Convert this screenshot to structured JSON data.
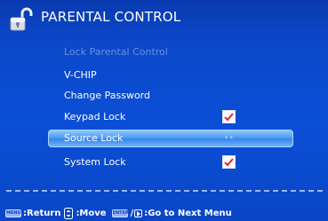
{
  "header": {
    "title": "PARENTAL CONTROL",
    "icon": "padlock-icon"
  },
  "menu": {
    "items": [
      {
        "label": "Lock Parental Control",
        "enabled": false,
        "checked": null
      },
      {
        "label": "V-CHIP",
        "enabled": true,
        "checked": null
      },
      {
        "label": "Change Password",
        "enabled": true,
        "checked": null
      },
      {
        "label": "Keypad Lock",
        "enabled": true,
        "checked": true
      },
      {
        "label": "Source Lock",
        "enabled": true,
        "checked": null,
        "selected": true,
        "indicator": "› ›"
      },
      {
        "label": "System Lock",
        "enabled": true,
        "checked": true
      }
    ]
  },
  "footer": {
    "menu_key": "MENU",
    "return_label": ":Return",
    "move_label": ":Move",
    "enter_key": "ENTER",
    "separator": "/",
    "next_label": ":Go to Next Menu"
  },
  "colors": {
    "background": "#0b4fd6",
    "highlight": "#4f9df5",
    "disabled_text": "#6b8fe3",
    "check": "#e0203a"
  }
}
